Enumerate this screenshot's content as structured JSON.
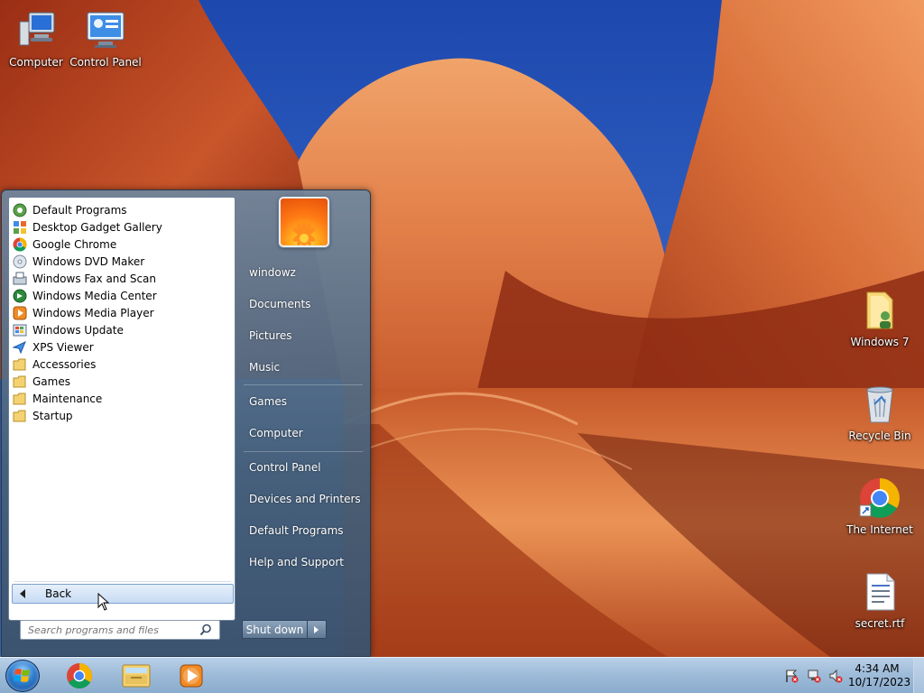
{
  "desktop": {
    "icons": [
      {
        "label": "Computer",
        "icon": "computer-icon"
      },
      {
        "label": "Control Panel",
        "icon": "control-panel-icon"
      },
      {
        "label": "Windows 7",
        "icon": "user-folder-icon"
      },
      {
        "label": "Recycle Bin",
        "icon": "recycle-bin-icon"
      },
      {
        "label": "The Internet",
        "icon": "chrome-icon"
      },
      {
        "label": "secret.rtf",
        "icon": "document-icon"
      }
    ]
  },
  "start_menu": {
    "programs": [
      {
        "label": "Default Programs",
        "icon": "default-programs-icon"
      },
      {
        "label": "Desktop Gadget Gallery",
        "icon": "gadget-icon"
      },
      {
        "label": "Google Chrome",
        "icon": "chrome-icon"
      },
      {
        "label": "Windows DVD Maker",
        "icon": "dvd-icon"
      },
      {
        "label": "Windows Fax and Scan",
        "icon": "fax-icon"
      },
      {
        "label": "Windows Media Center",
        "icon": "media-center-icon"
      },
      {
        "label": "Windows Media Player",
        "icon": "media-player-icon"
      },
      {
        "label": "Windows Update",
        "icon": "windows-update-icon"
      },
      {
        "label": "XPS Viewer",
        "icon": "xps-icon"
      },
      {
        "label": "Accessories",
        "icon": "folder-icon"
      },
      {
        "label": "Games",
        "icon": "folder-icon"
      },
      {
        "label": "Maintenance",
        "icon": "folder-icon"
      },
      {
        "label": "Startup",
        "icon": "folder-icon"
      }
    ],
    "back_label": "Back",
    "search_placeholder": "Search programs and files",
    "right_items": [
      "windowz",
      "Documents",
      "Pictures",
      "Music",
      "Games",
      "Computer",
      "Control Panel",
      "Devices and Printers",
      "Default Programs",
      "Help and Support"
    ],
    "shutdown_label": "Shut down"
  },
  "taskbar": {
    "pinned": [
      {
        "icon": "chrome-icon"
      },
      {
        "icon": "explorer-icon"
      },
      {
        "icon": "media-player-icon"
      }
    ],
    "clock_time": "4:34 AM",
    "clock_date": "10/17/2023"
  },
  "colors": {
    "accent": "#3b6bd0",
    "taskbar": "#9fbcd9",
    "menu_highlight": "#c7dcf4"
  }
}
